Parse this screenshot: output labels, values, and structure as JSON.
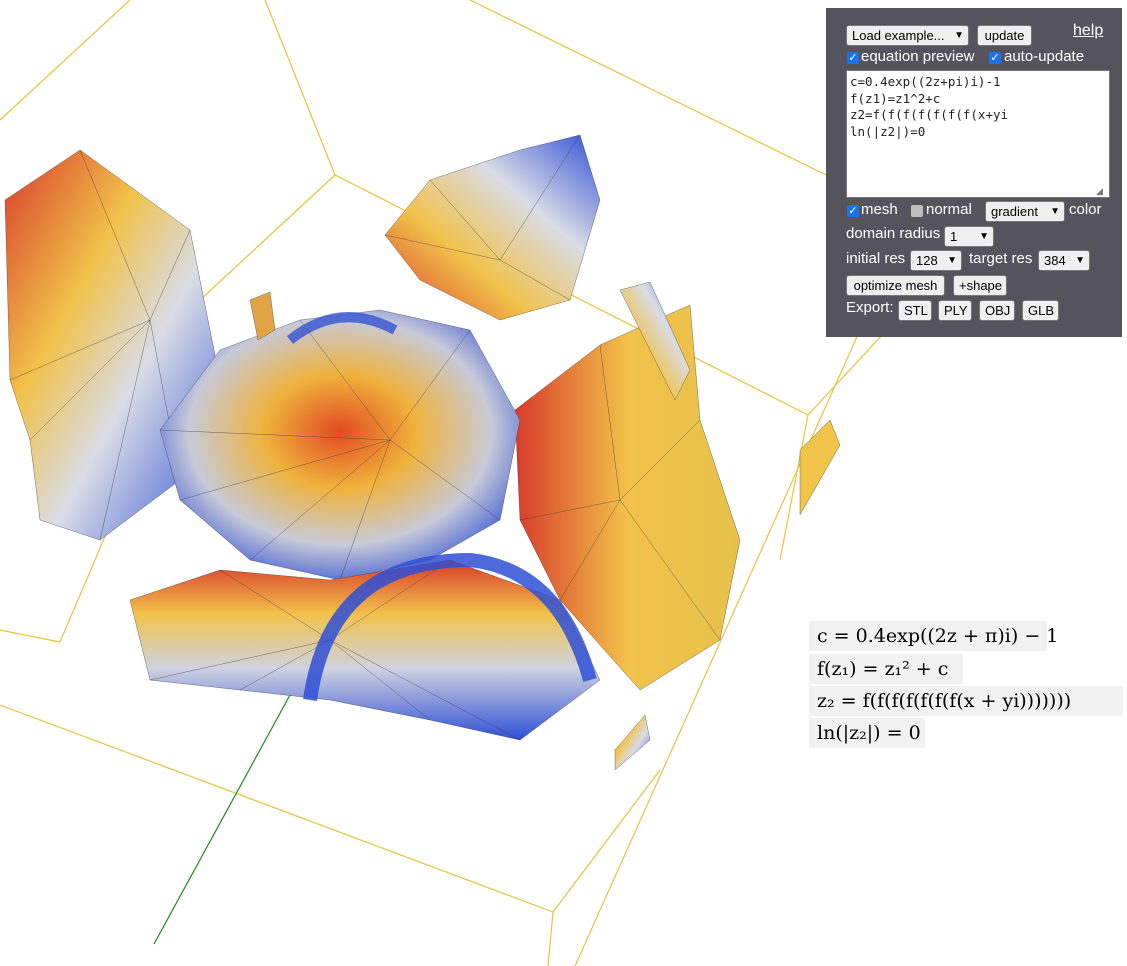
{
  "toolbar": {
    "example_select": "Load example...",
    "update_label": "update",
    "help_label": "help"
  },
  "options": {
    "equation_preview_label": "equation preview",
    "equation_preview_checked": true,
    "auto_update_label": "auto-update",
    "auto_update_checked": true
  },
  "equation_source": "c=0.4exp((2z+pi)i)-1\nf(z1)=z1^2+c\nz2=f(f(f(f(f(f(f(x+yi\nln(|z2|)=0",
  "display": {
    "mesh_label": "mesh",
    "mesh_checked": true,
    "normal_label": "normal",
    "normal_checked": false,
    "color_mode": "gradient",
    "color_label": "color"
  },
  "domain": {
    "label": "domain radius",
    "value": "1"
  },
  "resolution": {
    "initial_label": "initial res",
    "initial_value": "128",
    "target_label": "target res",
    "target_value": "384"
  },
  "actions": {
    "optimize_label": "optimize mesh",
    "shape_label": "+shape"
  },
  "export": {
    "label": "Export:",
    "formats": [
      "STL",
      "PLY",
      "OBJ",
      "GLB"
    ]
  },
  "rendered_equations": [
    "c = 0.4exp((2z + π)i) − 1",
    "f(z₁) = z₁² + c",
    "z₂ = f(f(f(f(f(f(f(x + yi)))))))",
    "ln(|z₂|) = 0"
  ],
  "colors": {
    "panel_bg": "#55545d",
    "bounding_box": "#e8c23a",
    "axis_x": "#d62020",
    "axis_y": "#1a8a1a",
    "axis_z": "#1a2ad0",
    "surface_gradient": [
      "#2f4fd6",
      "#d7dbe6",
      "#f2c24a",
      "#d83a2a"
    ]
  }
}
